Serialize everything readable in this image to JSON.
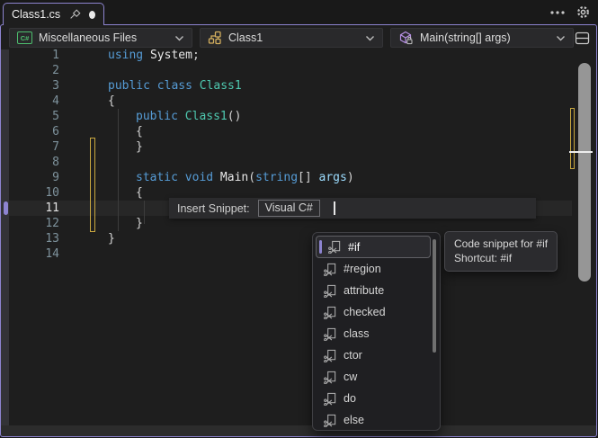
{
  "tab_strip": {
    "active_tab": {
      "label": "Class1.cs"
    }
  },
  "navbar": {
    "project_dropdown": {
      "label": "Miscellaneous Files",
      "icon_text": "C#"
    },
    "type_dropdown": {
      "label": "Class1"
    },
    "member_dropdown": {
      "label": "Main(string[] args)"
    }
  },
  "editor": {
    "line_numbers": [
      "1",
      "2",
      "3",
      "4",
      "5",
      "6",
      "7",
      "8",
      "9",
      "10",
      "11",
      "12",
      "13",
      "14"
    ],
    "current_line": "11",
    "code": {
      "line1": [
        "using ",
        "System",
        ";"
      ],
      "line3": [
        "public class ",
        "Class1"
      ],
      "line4": [
        "{"
      ],
      "line5": [
        "public ",
        "Class1",
        "()"
      ],
      "line6": [
        "{"
      ],
      "line7": [
        "}"
      ],
      "line9": [
        "static void ",
        "Main",
        "(",
        "string",
        "[] ",
        "args",
        ")"
      ],
      "line10": [
        "{"
      ],
      "line12": [
        "}"
      ],
      "line13": [
        "}"
      ]
    }
  },
  "snippet_bar": {
    "label": "Insert Snippet:",
    "language_scope": "Visual C#"
  },
  "snippet_list": {
    "items": [
      "#if",
      "#region",
      "attribute",
      "checked",
      "class",
      "ctor",
      "cw",
      "do",
      "else"
    ],
    "selected": "#if"
  },
  "tooltip": {
    "line1": "Code snippet for #if",
    "line2": "Shortcut: #if"
  },
  "colors": {
    "accent_purple": "#8D84D0",
    "modified_yellow": "#C9A73F",
    "keyword_blue": "#569CD6",
    "type_teal": "#4EC9B0",
    "parameter_blue": "#9CDCFE",
    "csharp_green": "#4DBE6E",
    "method_purple": "#B48EE0",
    "class_gold": "#D4AF5E"
  }
}
